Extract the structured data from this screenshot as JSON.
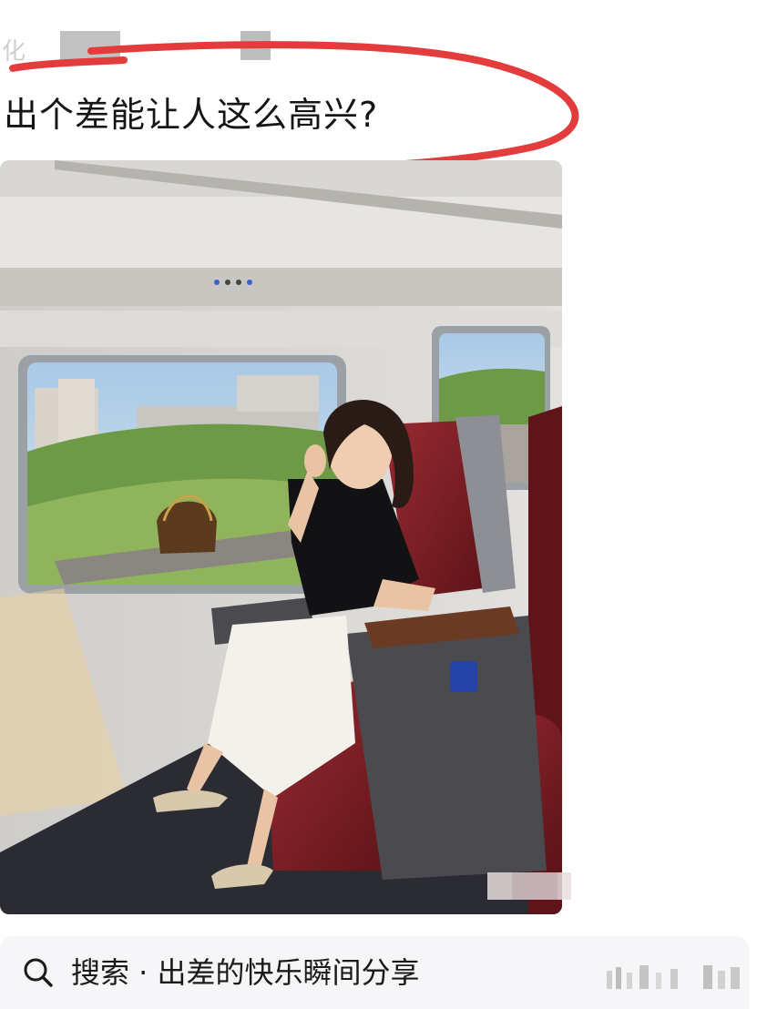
{
  "header": {
    "author_glyph": "化"
  },
  "post": {
    "title": "出个差能让人这么高兴?"
  },
  "search": {
    "icon": "search-icon",
    "label": "搜索 · 出差的快乐瞬间分享"
  },
  "colors": {
    "annotation": "#e23c3c",
    "seat": "#7a1f26",
    "background": "#ffffff",
    "search_bg": "#f6f6f8"
  }
}
